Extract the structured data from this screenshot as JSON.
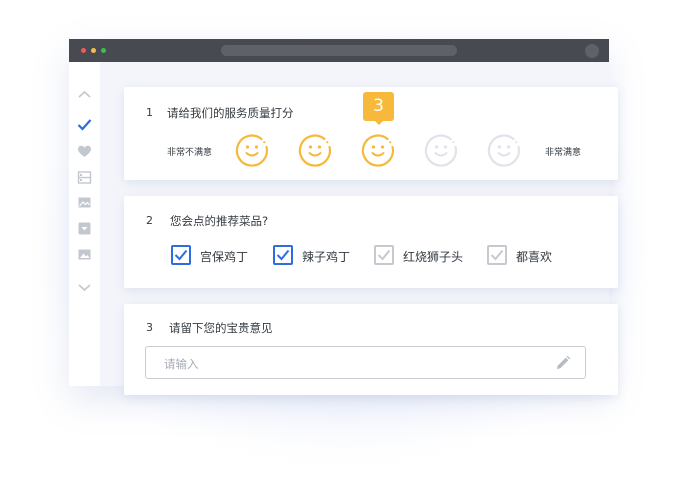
{
  "window": {
    "dots": [
      "red",
      "yellow",
      "green"
    ]
  },
  "sidebar": {
    "icons": [
      "chevron-up-icon",
      "check-icon",
      "heart-icon",
      "list-icon",
      "image-icon",
      "dropdown-icon",
      "picture-icon",
      "chevron-down-icon"
    ],
    "active_color": "#2d6de0",
    "icon_color": "#c3c8d0"
  },
  "survey": {
    "q1": {
      "number": "1",
      "text": "请给我们的服务质量打分",
      "low_label": "非常不满意",
      "high_label": "非常满意",
      "rating_max": 5,
      "rating_value": 3,
      "badge_text": "3",
      "active_color": "#f6b93b",
      "inactive_color": "#dfe4ea"
    },
    "q2": {
      "number": "2",
      "text": "您会点的推荐菜品?",
      "options": [
        {
          "label": "宫保鸡丁",
          "checked": true
        },
        {
          "label": "辣子鸡丁",
          "checked": true
        },
        {
          "label": "红烧狮子头",
          "checked": false
        },
        {
          "label": "都喜欢",
          "checked": false
        }
      ],
      "checked_color": "#2d6de0"
    },
    "q3": {
      "number": "3",
      "text": "请留下您的宝贵意见",
      "input_placeholder": "请输入",
      "input_value": ""
    }
  }
}
